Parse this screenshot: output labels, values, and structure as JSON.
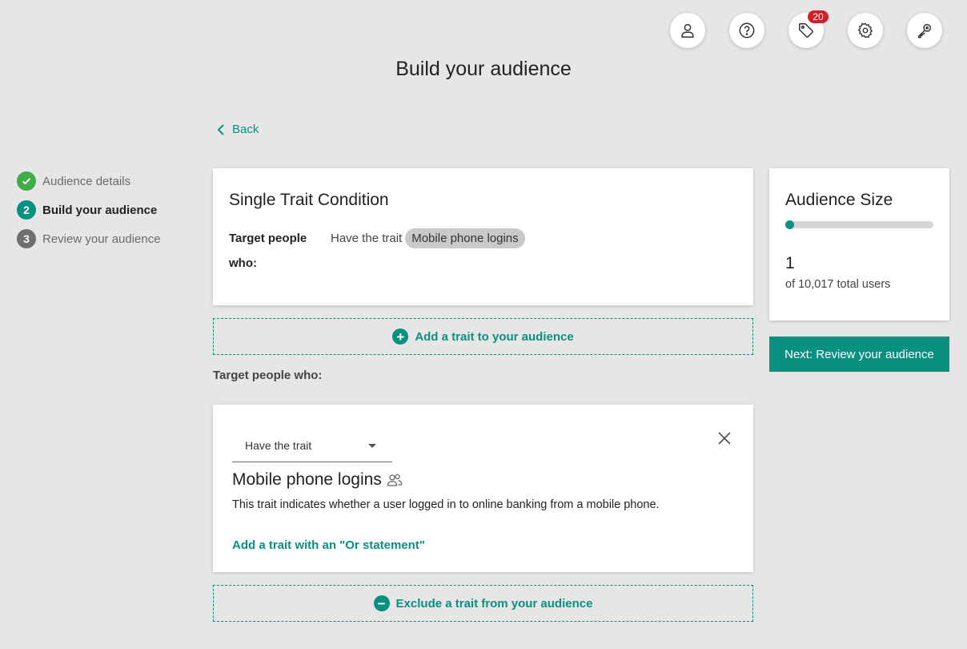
{
  "header": {
    "title": "Build your audience",
    "icons": [
      {
        "name": "user-icon"
      },
      {
        "name": "help-icon"
      },
      {
        "name": "tag-icon",
        "badge": "20"
      },
      {
        "name": "gear-icon"
      },
      {
        "name": "key-icon"
      }
    ]
  },
  "nav": {
    "back_label": "Back"
  },
  "stepper": {
    "steps": [
      {
        "marker": "check",
        "label": "Audience details",
        "state": "completed"
      },
      {
        "marker": "2",
        "label": "Build your audience",
        "state": "active"
      },
      {
        "marker": "3",
        "label": "Review your audience",
        "state": "upcoming"
      }
    ]
  },
  "summary": {
    "title": "Single Trait Condition",
    "target_label": "Target people",
    "condition_text": "Have the trait",
    "trait_chip": "Mobile phone logins",
    "who_label": "who:"
  },
  "actions": {
    "add_trait": "Add a trait to your audience",
    "exclude_trait": "Exclude a trait from your audience"
  },
  "target_section": {
    "label": "Target people who:"
  },
  "trait_card": {
    "select_value": "Have the trait",
    "trait_name": "Mobile phone logins",
    "description": "This trait indicates whether a user logged in to online banking from a mobile phone.",
    "or_link": "Add a trait with an \"Or statement\""
  },
  "audience_size": {
    "title": "Audience Size",
    "count": "1",
    "total_text": "of 10,017 total users",
    "fraction": 0.0001
  },
  "next_button": {
    "label": "Next: Review your audience"
  },
  "colors": {
    "accent": "#0a9080",
    "background": "#e6e6e6",
    "check_green": "#3fae49",
    "step_gray": "#6f6f6f",
    "badge_red": "#d0202a"
  }
}
